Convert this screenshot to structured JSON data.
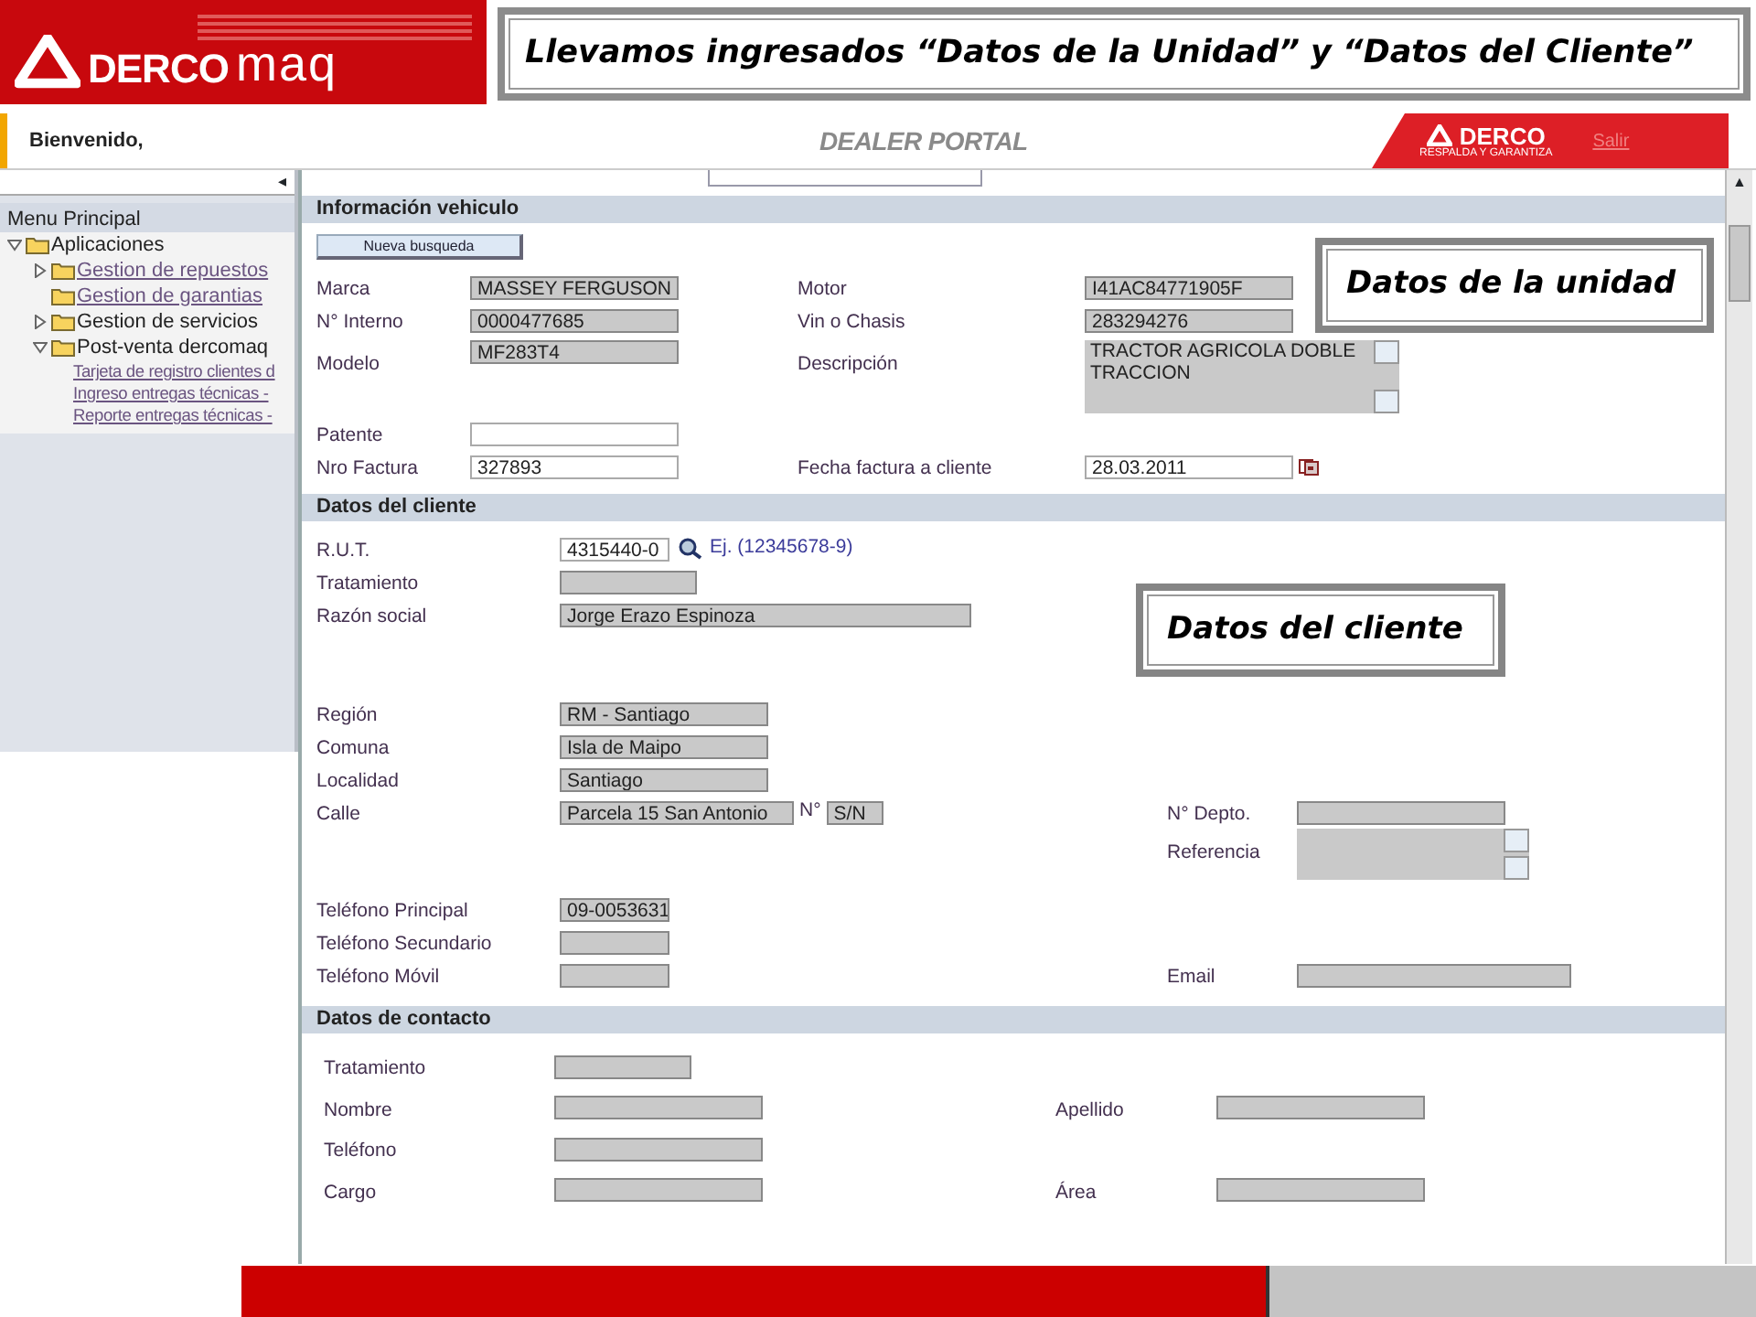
{
  "slide": {
    "logo": {
      "brand": "DERCO",
      "suffix": "maq"
    },
    "title": "Llevamos ingresados “Datos de la Unidad” y “Datos del Cliente”",
    "callouts": [
      "Datos de la unidad",
      "Datos del cliente"
    ]
  },
  "app": {
    "welcome": "Bienvenido,",
    "portal_title": "DEALER PORTAL",
    "brand": {
      "name": "DERCO",
      "tagline": "RESPALDA Y GARANTIZA"
    },
    "logout": "Salir",
    "scroll_up": "▲"
  },
  "sidebar": {
    "collapse": "◂",
    "title": "Menu Principal",
    "items": [
      {
        "kind": "folder",
        "label": "Aplicaciones",
        "expanded": true,
        "children": [
          {
            "kind": "folder",
            "label": "Gestion de repuestos",
            "linked": true,
            "expanded": false
          },
          {
            "kind": "folder",
            "label": "Gestion de garantias",
            "linked": true
          },
          {
            "kind": "folder",
            "label": "Gestion de servicios",
            "linked": false,
            "expanded": false
          },
          {
            "kind": "folder",
            "label": "Post-venta dercomaq",
            "linked": false,
            "expanded": true,
            "children": [
              {
                "kind": "link",
                "label": "Tarjeta de registro clientes d"
              },
              {
                "kind": "link",
                "label": "Ingreso entregas técnicas -"
              },
              {
                "kind": "link",
                "label": "Reporte entregas técnicas -"
              }
            ]
          }
        ]
      }
    ]
  },
  "sections": [
    {
      "title": "Información vehiculo",
      "action": "Nueva busqueda",
      "groups": [
        [
          {
            "left": {
              "label": "Marca",
              "kind": "readonly",
              "value": "MASSEY FERGUSON"
            },
            "right": {
              "label": "Motor",
              "kind": "readonly",
              "value": "I41AC84771905F"
            }
          },
          {
            "left": {
              "label": "N° Interno",
              "kind": "readonly",
              "value": "0000477685"
            },
            "right": {
              "label": "Vin o Chasis",
              "kind": "readonly",
              "value": "283294276"
            }
          },
          {
            "left": {
              "label": "Modelo",
              "kind": "readonly",
              "value": "MF283T4"
            },
            "right": {
              "label": "Descripción",
              "kind": "textarea",
              "value": " TRACTOR AGRICOLA DOBLE TRACCION"
            }
          },
          {
            "left": {
              "label": "Patente",
              "kind": "input"
            }
          },
          {
            "left": {
              "label": "Nro Factura",
              "kind": "input",
              "value": "327893"
            },
            "right": {
              "label": "Fecha factura a cliente",
              "kind": "input",
              "value": "28.03.2011",
              "calendar": true
            }
          }
        ]
      ]
    },
    {
      "title": "Datos del cliente",
      "groups": [
        [
          {
            "left": {
              "label": "R.U.T.",
              "kind": "input",
              "value": "4315440-0",
              "lookup": true,
              "hint": "Ej. (12345678-9)"
            }
          },
          {
            "left": {
              "label": "Tratamiento",
              "kind": "readonly"
            }
          },
          {
            "left": {
              "label": "Razón social",
              "kind": "readonly",
              "value": "Jorge Erazo Espinoza"
            }
          }
        ],
        [
          {
            "left": {
              "label": "Región",
              "kind": "readonly",
              "value": "RM - Santiago"
            }
          },
          {
            "left": {
              "label": "Comuna",
              "kind": "readonly",
              "value": "Isla de Maipo"
            }
          },
          {
            "left": {
              "label": "Localidad",
              "kind": "readonly",
              "value": "Santiago"
            }
          },
          {
            "left": {
              "label": "Calle",
              "kind": "readonly",
              "value": "Parcela 15 San Antonio",
              "number": {
                "label": "N°",
                "value": "S/N"
              }
            },
            "right": {
              "label": "N° Depto.",
              "kind": "readonly"
            }
          },
          {
            "right": {
              "label": "Referencia",
              "kind": "textarea"
            }
          }
        ],
        [
          {
            "left": {
              "label": "Teléfono Principal",
              "kind": "readonly",
              "value": "09-0053631"
            }
          },
          {
            "left": {
              "label": "Teléfono Secundario",
              "kind": "readonly"
            }
          },
          {
            "left": {
              "label": "Teléfono Móvil",
              "kind": "readonly"
            },
            "right": {
              "label": "Email",
              "kind": "readonly"
            }
          }
        ]
      ]
    },
    {
      "title": "Datos de contacto",
      "groups": [
        [
          {
            "left": {
              "label": "Tratamiento",
              "kind": "readonly"
            }
          },
          {
            "left": {
              "label": "Nombre",
              "kind": "readonly"
            },
            "right": {
              "label": "Apellido",
              "kind": "readonly"
            }
          },
          {
            "left": {
              "label": "Teléfono",
              "kind": "readonly"
            }
          },
          {
            "left": {
              "label": "Cargo",
              "kind": "readonly"
            },
            "right": {
              "label": "Área",
              "kind": "readonly"
            }
          }
        ]
      ]
    }
  ]
}
